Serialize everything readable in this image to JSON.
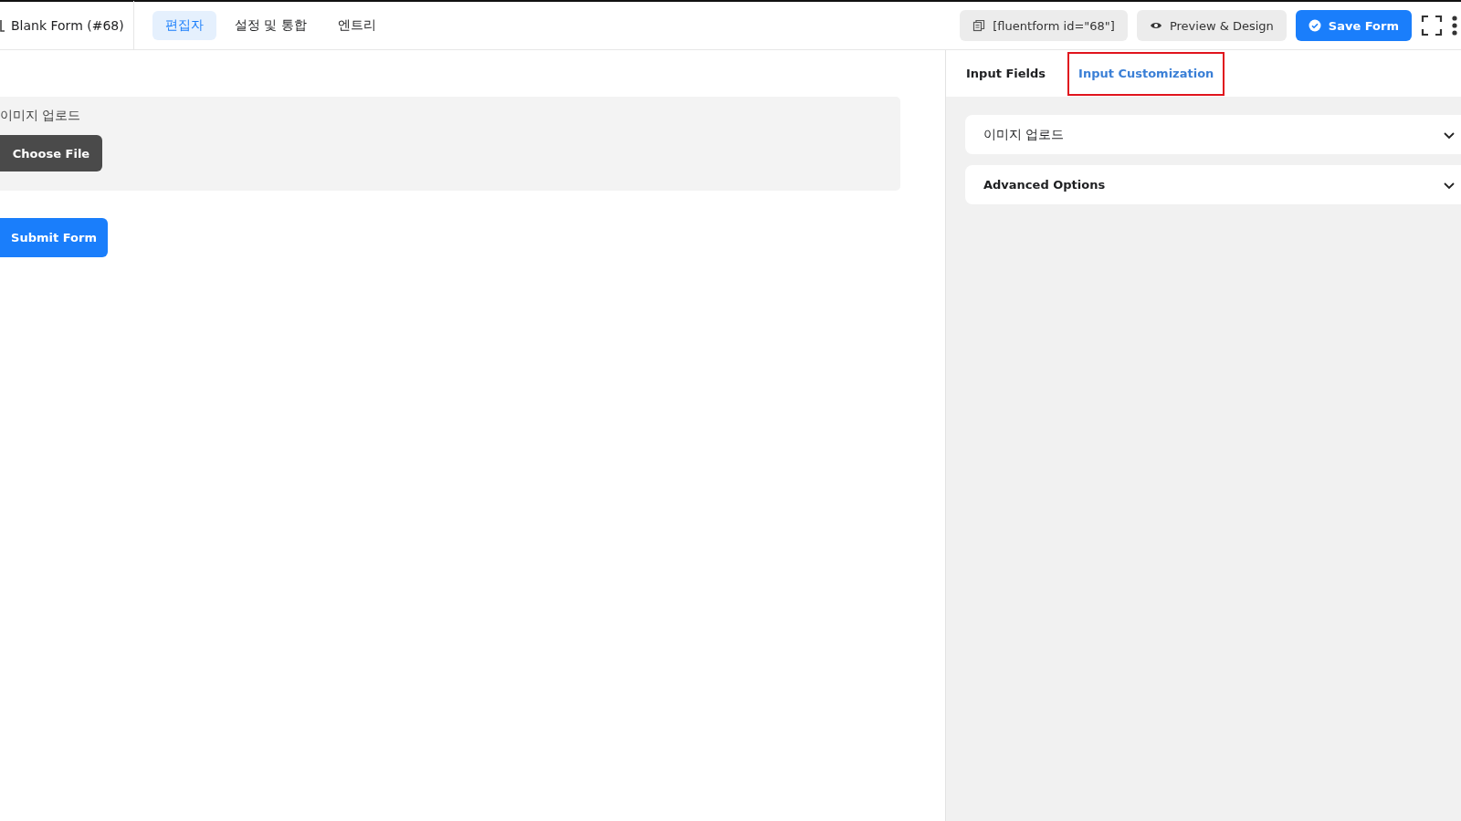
{
  "header": {
    "title": "Blank Form (#68)",
    "tabs": [
      {
        "label": "편집자",
        "selected": true
      },
      {
        "label": "설정 및 통합",
        "selected": false
      },
      {
        "label": "엔트리",
        "selected": false
      }
    ],
    "shortcode": "[fluentform id=\"68\"]",
    "preview_button": "Preview & Design",
    "save_button": "Save Form"
  },
  "form": {
    "field_label": "이미지 업로드",
    "file_button": "Choose File",
    "submit_button": "Submit Form"
  },
  "panel": {
    "tabs": [
      {
        "label": "Input Fields",
        "selected": false,
        "highlighted": false
      },
      {
        "label": "Input Customization",
        "selected": true,
        "highlighted": true
      }
    ],
    "sections": [
      {
        "title": "이미지 업로드",
        "expanded": false,
        "kind": "plain"
      },
      {
        "title": "Advanced Options",
        "expanded": false,
        "kind": "bold"
      }
    ]
  }
}
